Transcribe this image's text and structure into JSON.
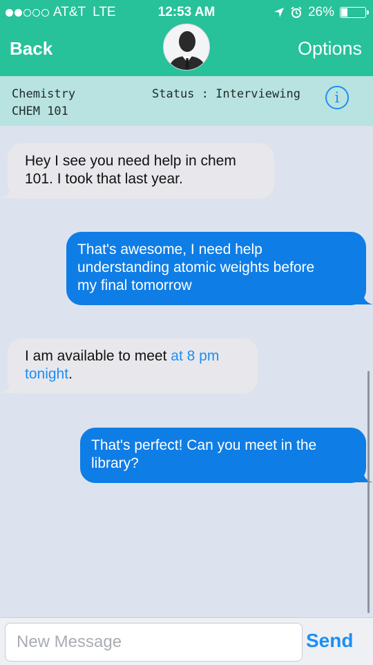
{
  "status_bar": {
    "carrier": "AT&T",
    "network": "LTE",
    "time": "12:53 AM",
    "battery": "26%",
    "battery_level": 0.26,
    "signal_strength": 2
  },
  "nav": {
    "back_label": "Back",
    "options_label": "Options"
  },
  "subheader": {
    "course_name": "Chemistry",
    "course_code": "CHEM 101",
    "status": "Status : Interviewing",
    "info_glyph": "i"
  },
  "messages": [
    {
      "direction": "incoming",
      "lines": [
        "Hey I see you need help in chem",
        "101. I took that last year."
      ]
    },
    {
      "direction": "outgoing",
      "lines": [
        "That's awesome, I need help",
        "understanding atomic weights before",
        "my final tomorrow"
      ]
    },
    {
      "direction": "incoming",
      "line1_text": "I am available to meet ",
      "line1_link": "at 8 pm",
      "line2_link": "tonight",
      "line2_text": "."
    },
    {
      "direction": "outgoing",
      "lines": [
        "That's perfect! Can you meet in the",
        "library?"
      ]
    }
  ],
  "composer": {
    "placeholder": "New Message",
    "value": "",
    "send_label": "Send"
  },
  "colors": {
    "header": "#27c19a",
    "subheader": "#b8e3e0",
    "background": "#dde3ee",
    "incoming_bubble": "#e8e8ec",
    "outgoing_bubble": "#0f7de6",
    "link": "#1d8ef5"
  },
  "icons": [
    "signal-dots-icon",
    "location-arrow-icon",
    "alarm-icon",
    "battery-icon",
    "contact-avatar-icon",
    "info-icon"
  ]
}
